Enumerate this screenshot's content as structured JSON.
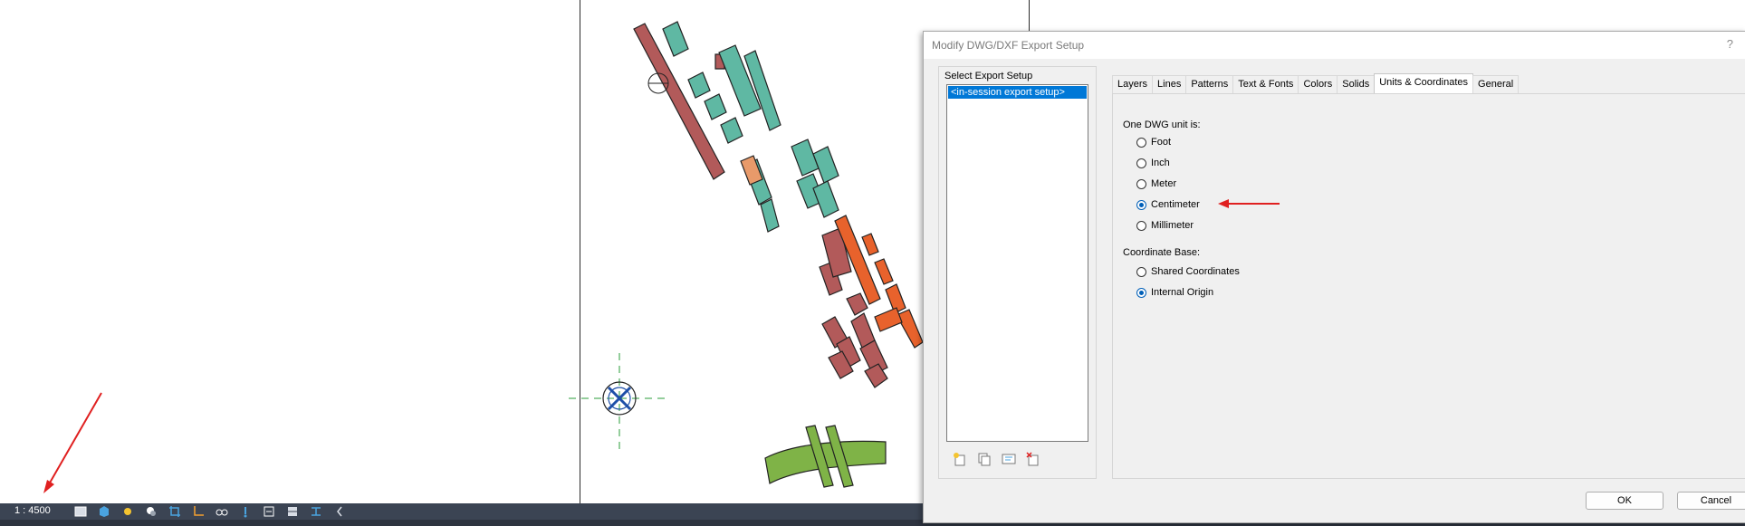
{
  "status_bar": {
    "scale": "1 : 4500",
    "icons": [
      "detail-level-icon",
      "visual-style-icon",
      "sun-path-icon",
      "shadows-icon",
      "crop-view-icon",
      "show-crop-icon",
      "unlock-3d-icon",
      "temporary-hide-icon",
      "reveal-hidden-icon",
      "analytical-model-icon",
      "highlight-displacement-icon",
      "collapse-arrow-icon"
    ]
  },
  "dialog": {
    "title": "Modify DWG/DXF Export Setup",
    "help": "?",
    "select_export_setup_label": "Select Export Setup",
    "setups": [
      "<in-session export setup>"
    ],
    "setup_tools": [
      "new-setup-icon",
      "duplicate-setup-icon",
      "rename-setup-icon",
      "delete-setup-icon"
    ],
    "tabs": [
      "Layers",
      "Lines",
      "Patterns",
      "Text & Fonts",
      "Colors",
      "Solids",
      "Units & Coordinates",
      "General"
    ],
    "active_tab": "Units & Coordinates",
    "unit_label": "One DWG unit is:",
    "units": [
      "Foot",
      "Inch",
      "Meter",
      "Centimeter",
      "Millimeter"
    ],
    "selected_unit": "Centimeter",
    "coordinate_label": "Coordinate Base:",
    "coordinates": [
      "Shared Coordinates",
      "Internal Origin"
    ],
    "selected_coordinate": "Internal Origin",
    "ok": "OK",
    "cancel": "Cancel"
  },
  "colors": {
    "annotation_arrow": "#e02020",
    "selection": "#0078d7",
    "status_bar": "#3b4453",
    "building_red": "#b25a5a",
    "building_teal": "#5fb8a3",
    "building_orange": "#e8622c",
    "green_area": "#7fb347"
  }
}
